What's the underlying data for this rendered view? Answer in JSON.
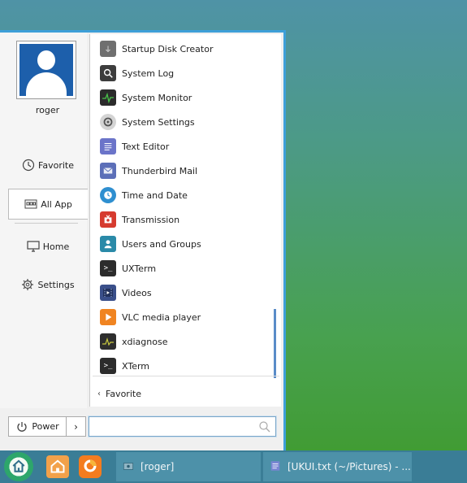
{
  "user": {
    "name": "roger"
  },
  "sidebar": {
    "favorite": "Favorite",
    "all_app": "All App",
    "home": "Home",
    "settings": "Settings"
  },
  "apps": [
    {
      "label": "Startup Disk Creator",
      "icon": "usb-drive-icon",
      "color": "#6f6f6f"
    },
    {
      "label": "System Log",
      "icon": "magnifier-icon",
      "color": "#3d3d3d"
    },
    {
      "label": "System Monitor",
      "icon": "activity-graph-icon",
      "color": "#2b2b2b"
    },
    {
      "label": "System Settings",
      "icon": "gear-icon",
      "color": "#bdbdbd"
    },
    {
      "label": "Text Editor",
      "icon": "text-document-icon",
      "color": "#6b74c9"
    },
    {
      "label": "Thunderbird Mail",
      "icon": "mail-envelope-icon",
      "color": "#5c6fb8"
    },
    {
      "label": "Time and Date",
      "icon": "clock-icon",
      "color": "#2f8fd0"
    },
    {
      "label": "Transmission",
      "icon": "transmission-icon",
      "color": "#d63b2f"
    },
    {
      "label": "Users and Groups",
      "icon": "users-icon",
      "color": "#2a8aa8"
    },
    {
      "label": "UXTerm",
      "icon": "terminal-icon",
      "color": "#2c2c2c"
    },
    {
      "label": "Videos",
      "icon": "film-reel-icon",
      "color": "#3a4f8a"
    },
    {
      "label": "VLC media player",
      "icon": "vlc-cone-icon",
      "color": "#f08421"
    },
    {
      "label": "xdiagnose",
      "icon": "diagnose-graph-icon",
      "color": "#2e2e2e"
    },
    {
      "label": "XTerm",
      "icon": "terminal-icon",
      "color": "#2c2c2c"
    }
  ],
  "favorite_link": "Favorite",
  "power": {
    "label": "Power"
  },
  "search": {
    "placeholder": ""
  },
  "taskbar": {
    "tasks": [
      {
        "label": "[roger]"
      },
      {
        "label": "[UKUI.txt (~/Pictures) - ..."
      }
    ]
  },
  "colors": {
    "accent": "#3e9fd8",
    "taskbar": "#3a7d96",
    "task_button": "#4d91a9"
  }
}
